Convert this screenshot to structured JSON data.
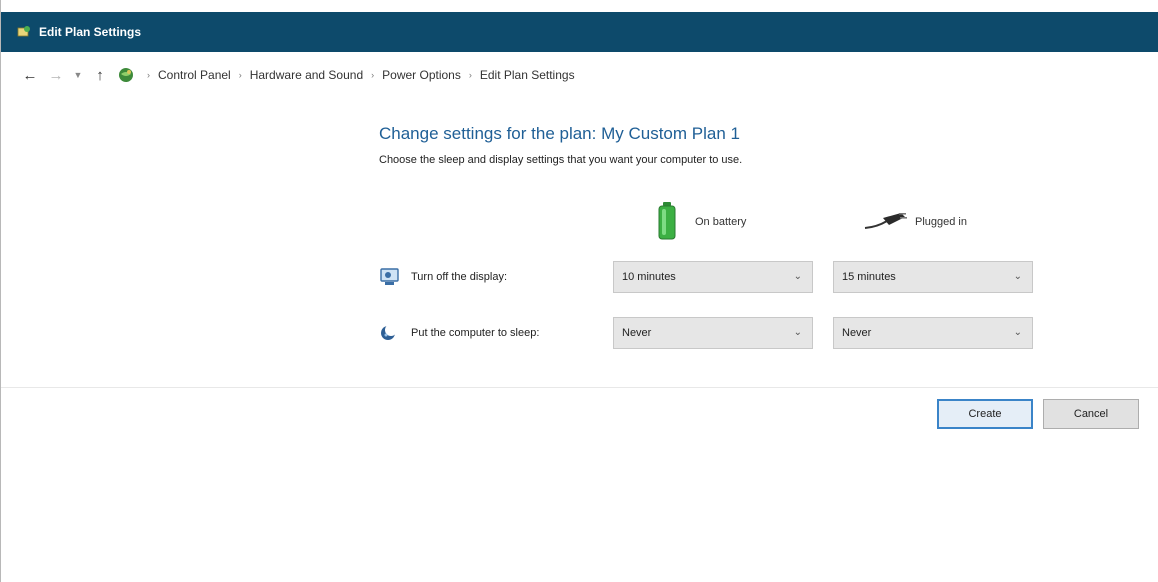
{
  "window": {
    "title": "Edit Plan Settings"
  },
  "address_bar": {
    "breadcrumbs": [
      "Control Panel",
      "Hardware and Sound",
      "Power Options",
      "Edit Plan Settings"
    ]
  },
  "main": {
    "heading": "Change settings for the plan: My Custom Plan 1",
    "subheading": "Choose the sleep and display settings that you want your computer to use.",
    "columns": {
      "battery": "On battery",
      "plugged": "Plugged in"
    },
    "settings": [
      {
        "label": "Turn off the display:",
        "on_battery": "10 minutes",
        "plugged_in": "15 minutes"
      },
      {
        "label": "Put the computer to sleep:",
        "on_battery": "Never",
        "plugged_in": "Never"
      }
    ]
  },
  "buttons": {
    "create": "Create",
    "cancel": "Cancel"
  },
  "colors": {
    "titlebar": "#0d4a6b",
    "heading": "#1f5f96",
    "battery_green": "#3cb043",
    "default_button_border": "#3a84c8"
  },
  "icons": {
    "app": "control-panel-icon",
    "back": "back-arrow-icon",
    "forward": "forward-arrow-icon",
    "recent": "chevron-down-icon",
    "up": "up-arrow-icon",
    "location": "control-panel-globe-icon",
    "battery": "battery-icon",
    "plug": "power-plug-icon",
    "display": "monitor-icon",
    "sleep": "moon-icon",
    "dropdown": "chevron-down-icon"
  }
}
